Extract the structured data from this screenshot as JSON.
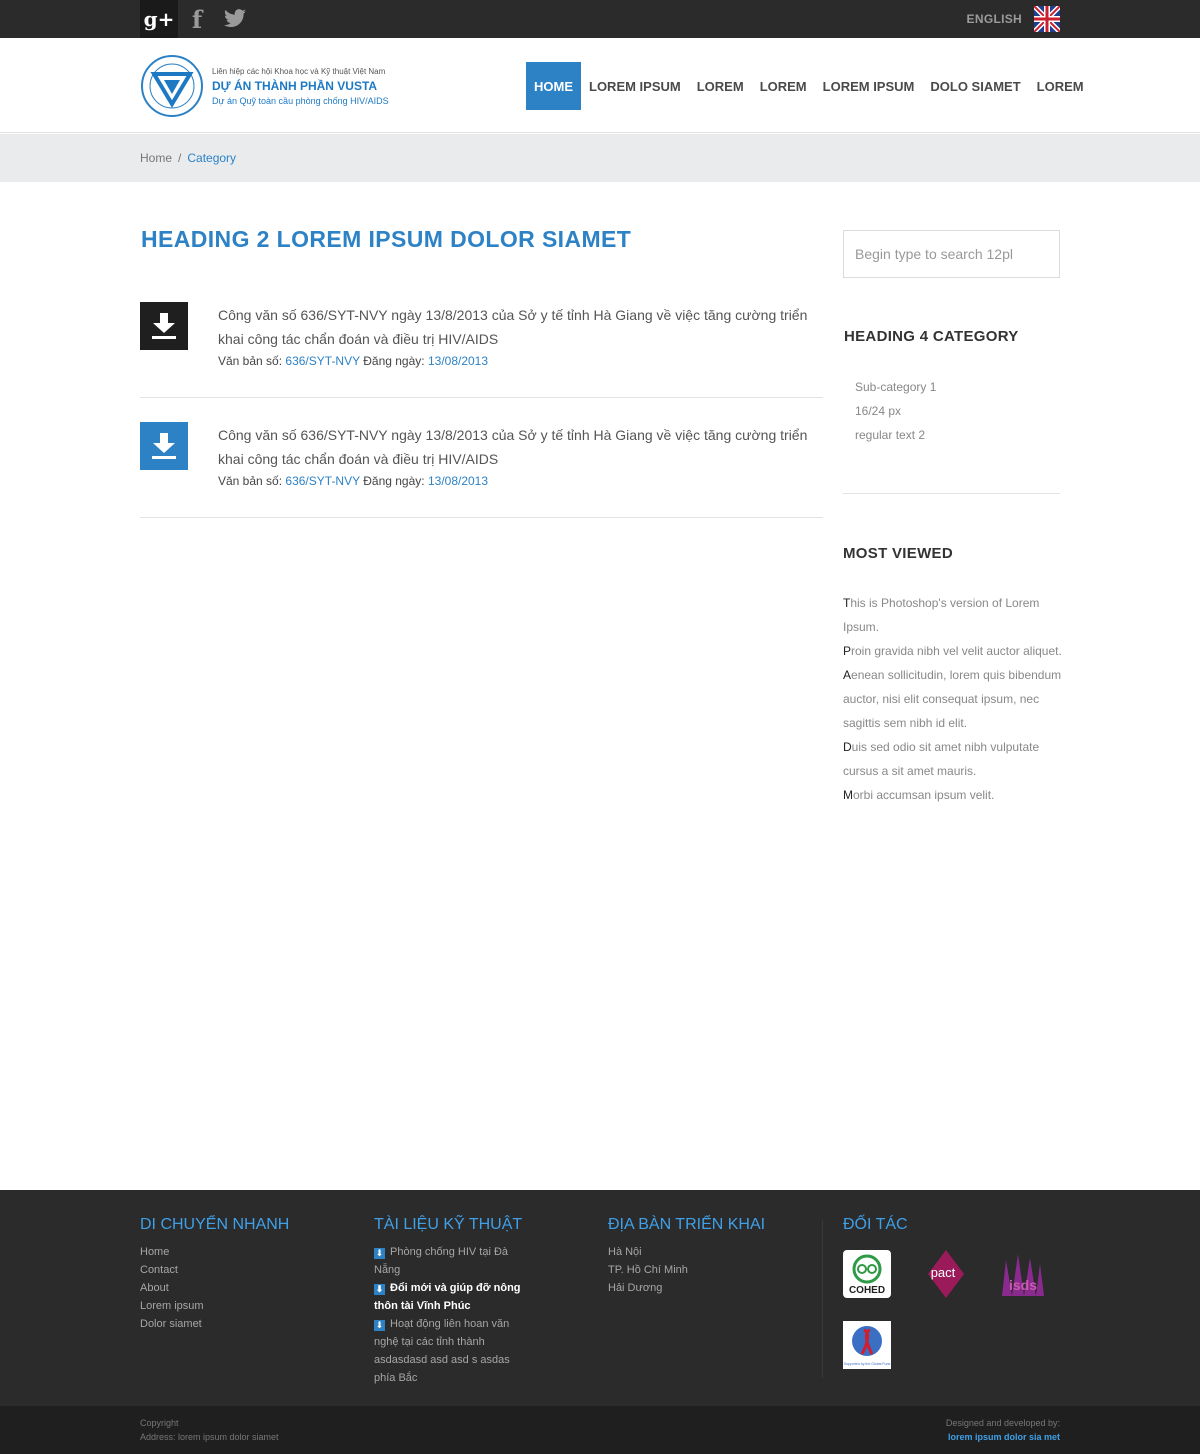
{
  "topbar": {
    "social": [
      "g+",
      "f",
      "twitter"
    ],
    "language": "ENGLISH",
    "flag_icon": "uk-flag-icon"
  },
  "logo": {
    "line1": "Liên hiệp các hội Khoa học và Kỹ thuật Việt Nam",
    "line2": "DỰ ÁN THÀNH PHẦN VUSTA",
    "line3": "Dự án Quỹ toàn cầu phòng chống HIV/AIDS"
  },
  "nav": {
    "items": [
      "HOME",
      "LOREM IPSUM",
      "LOREM",
      "LOREM",
      "LOREM IPSUM",
      "DOLO SIAMET",
      "LOREM"
    ],
    "active_index": 0
  },
  "breadcrumb": {
    "home": "Home",
    "separator": "/",
    "current": "Category"
  },
  "main": {
    "title": "HEADING 2 LOREM IPSUM DOLOR SIAMET",
    "docs": [
      {
        "icon": "download-icon",
        "title": "Công văn số 636/SYT-NVY ngày 13/8/2013 của Sở y tế tỉnh Hà Giang về việc tăng cường triển khai công tác chẩn đoán và điều trị HIV/AIDS",
        "meta_label": "Văn bản số:",
        "number": "636/SYT-NVY",
        "date_label": "Đăng ngày:",
        "date": "13/08/2013"
      },
      {
        "icon": "download-icon",
        "title": "Công văn số 636/SYT-NVY ngày 13/8/2013 của Sở y tế tỉnh Hà Giang về việc tăng cường triển khai công tác chẩn đoán và điều trị HIV/AIDS",
        "meta_label": "Văn bản số:",
        "number": "636/SYT-NVY",
        "date_label": "Đăng ngày:",
        "date": "13/08/2013"
      }
    ]
  },
  "sidebar": {
    "search_placeholder": "Begin type to search 12pl",
    "category_heading": "HEADING 4 CATEGORY",
    "categories": [
      "Sub-category 1",
      "16/24 px",
      "regular text 2"
    ],
    "most_viewed_heading": "MOST VIEWED",
    "most_viewed": [
      "This is Photoshop's version  of Lorem Ipsum.",
      "Proin gravida nibh vel velit auctor aliquet.",
      "Aenean sollicitudin, lorem quis bibendum auctor, nisi elit consequat ipsum, nec sagittis sem nibh id elit.",
      "Duis sed odio sit amet nibh vulputate cursus a sit amet mauris.",
      "Morbi accumsan ipsum velit."
    ]
  },
  "footer": {
    "quicknav": {
      "heading": "DI CHUYỂN NHANH",
      "links": [
        "Home",
        "Contact",
        "About",
        "Lorem ipsum",
        "Dolor siamet"
      ]
    },
    "docs": {
      "heading": "TÀI LIỆU KỸ THUẬT",
      "items": [
        "Phòng chống HIV tại Đà Nẵng",
        "Đổi mới và giúp đỡ nông thôn tài Vĩnh Phúc",
        "Hoạt động liên hoan văn nghệ tại các tỉnh thành asdasdasd asd asd s asdas phía Bắc"
      ],
      "highlight_index": 1
    },
    "areas": {
      "heading": "ĐỊA BÀN TRIỂN KHAI",
      "items": [
        "Hà Nội",
        "TP. Hồ Chí Minh",
        "Hải Dương"
      ]
    },
    "partners": {
      "heading": "ĐỐI TÁC",
      "logos": [
        "COHED",
        "pact",
        "isds",
        "Supported by the Global Fund"
      ]
    },
    "copyright": "Copyright",
    "address": "Address: lorem ipsum dolor siamet",
    "designed_label": "Designed and developed by:",
    "developer": "lorem ipsum dolor sia met"
  },
  "colors": {
    "accent": "#2d82c6",
    "footer_bg": "#2b2b2b",
    "footer_heading": "#3fa0e8",
    "topbar_bg": "#2b2b2b"
  }
}
